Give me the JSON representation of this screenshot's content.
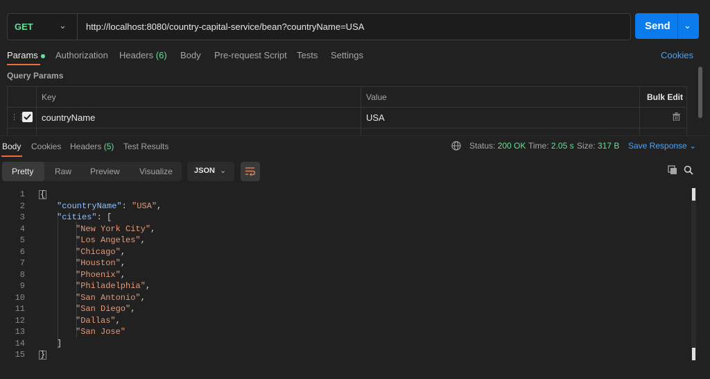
{
  "request": {
    "method": "GET",
    "url": "http://localhost:8080/country-capital-service/bean?countryName=USA",
    "send_label": "Send"
  },
  "request_tabs": [
    {
      "label": "Params",
      "count": ""
    },
    {
      "label": "Authorization",
      "count": ""
    },
    {
      "label": "Headers",
      "count": "(6)"
    },
    {
      "label": "Body",
      "count": ""
    },
    {
      "label": "Pre-request Script",
      "count": ""
    },
    {
      "label": "Tests",
      "count": ""
    },
    {
      "label": "Settings",
      "count": ""
    }
  ],
  "cookies_label": "Cookies",
  "query_params": {
    "title": "Query Params",
    "key_header": "Key",
    "value_header": "Value",
    "bulk_edit": "Bulk Edit",
    "rows": [
      {
        "key": "countryName",
        "value": "USA",
        "checked": true
      }
    ]
  },
  "response_tabs": [
    {
      "label": "Body",
      "count": ""
    },
    {
      "label": "Cookies",
      "count": ""
    },
    {
      "label": "Headers",
      "count": "(5)"
    },
    {
      "label": "Test Results",
      "count": ""
    }
  ],
  "response_meta": {
    "status_label": "Status:",
    "status_value": "200 OK",
    "time_label": "Time:",
    "time_value": "2.05 s",
    "size_label": "Size:",
    "size_value": "317 B",
    "save_label": "Save Response"
  },
  "format_tabs": [
    "Pretty",
    "Raw",
    "Preview",
    "Visualize"
  ],
  "format_select": "JSON",
  "code": {
    "line_numbers": [
      "1",
      "2",
      "3",
      "4",
      "5",
      "6",
      "7",
      "8",
      "9",
      "10",
      "11",
      "12",
      "13",
      "14",
      "15"
    ],
    "open_brace": "{",
    "country_key": "\"countryName\"",
    "country_value": "\"USA\"",
    "cities_key": "\"cities\"",
    "cities": [
      "\"New York City\"",
      "\"Los Angeles\"",
      "\"Chicago\"",
      "\"Houston\"",
      "\"Phoenix\"",
      "\"Philadelphia\"",
      "\"San Antonio\"",
      "\"San Diego\"",
      "\"Dallas\"",
      "\"San Jose\""
    ],
    "close_bracket": "]",
    "close_brace": "}"
  },
  "colors": {
    "accent_tab": "#f26b3a",
    "send_button": "#097bed",
    "status_green": "#6bdd9a",
    "link_blue": "#4aa3f5"
  }
}
